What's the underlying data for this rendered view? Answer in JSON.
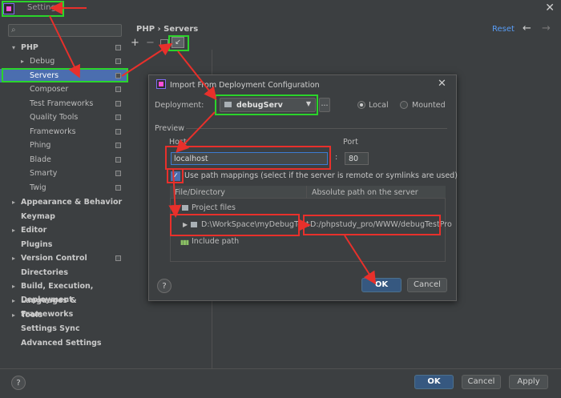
{
  "window": {
    "title": "Settings"
  },
  "sidebar": {
    "search_placeholder": "",
    "items": [
      {
        "label": "PHP",
        "bold": true,
        "arrow": "expanded"
      },
      {
        "label": "Debug",
        "arrow": "collapsed"
      },
      {
        "label": "Servers",
        "selected": true
      },
      {
        "label": "Composer"
      },
      {
        "label": "Test Frameworks"
      },
      {
        "label": "Quality Tools"
      },
      {
        "label": "Frameworks"
      },
      {
        "label": "Phing"
      },
      {
        "label": "Blade"
      },
      {
        "label": "Smarty"
      },
      {
        "label": "Twig"
      },
      {
        "label": "Appearance & Behavior",
        "bold": true,
        "arrow": "collapsed"
      },
      {
        "label": "Keymap",
        "bold": true
      },
      {
        "label": "Editor",
        "bold": true,
        "arrow": "collapsed"
      },
      {
        "label": "Plugins",
        "bold": true
      },
      {
        "label": "Version Control",
        "bold": true,
        "arrow": "collapsed"
      },
      {
        "label": "Directories",
        "bold": true
      },
      {
        "label": "Build, Execution, Deployment",
        "bold": true,
        "arrow": "collapsed"
      },
      {
        "label": "Languages & Frameworks",
        "bold": true,
        "arrow": "collapsed"
      },
      {
        "label": "Tools",
        "bold": true,
        "arrow": "collapsed"
      },
      {
        "label": "Settings Sync",
        "bold": true
      },
      {
        "label": "Advanced Settings",
        "bold": true
      }
    ]
  },
  "header": {
    "breadcrumb": "PHP  ›  Servers",
    "reset": "Reset",
    "back": "←",
    "forward": "→"
  },
  "toolbar": {
    "add": "+",
    "remove": "−"
  },
  "dialog": {
    "title": "Import From Deployment Configuration",
    "deployment_label": "Deployment:",
    "deployment_value": "debugServ",
    "more_button": "...",
    "radio_local": "Local",
    "radio_mounted": "Mounted",
    "preview_label": "Preview",
    "host_label": "Host",
    "host_value": "localhost",
    "port_label": "Port",
    "port_value": "80",
    "colon": ":",
    "use_mappings_label": "Use path mappings (select if the server is remote or symlinks are used)",
    "use_mappings_checked": true,
    "table": {
      "columns": [
        "File/Directory",
        "Absolute path on the server"
      ],
      "rows": [
        {
          "label": "Project files"
        },
        {
          "label": "D:\\WorkSpace\\myDebugTest",
          "value": "D:/phpstudy_pro/WWW/debugTestPro"
        },
        {
          "label": "Include path"
        }
      ]
    },
    "ok": "OK",
    "cancel": "Cancel",
    "help": "?"
  },
  "footer": {
    "ok": "OK",
    "cancel": "Cancel",
    "apply": "Apply",
    "help": "?"
  },
  "colors": {
    "accent": "#4b6eaf",
    "link": "#589df6",
    "highlight_green": "#2bd42b",
    "highlight_red": "#e8302b"
  }
}
